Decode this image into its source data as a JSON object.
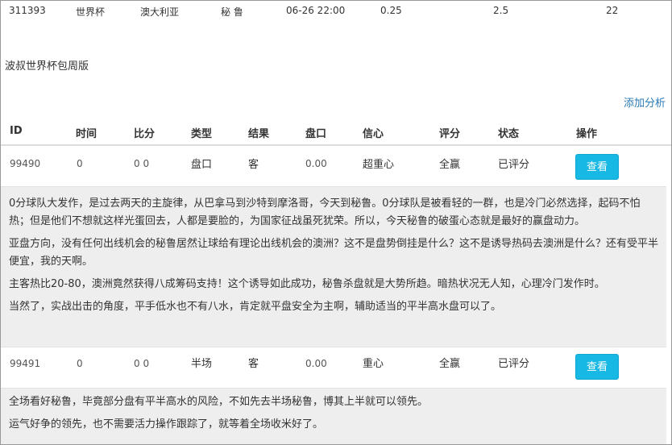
{
  "match": {
    "id": "311393",
    "league": "世界杯",
    "home": "澳大利亚",
    "away": "秘 鲁",
    "time": "06-26 22:00",
    "handicap": "0.25",
    "total": "2.5",
    "count": "22"
  },
  "package_title": "波叔世界杯包周版",
  "add_analysis_label": "添加分析",
  "table": {
    "headers": [
      "ID",
      "时间",
      "比分",
      "类型",
      "结果",
      "盘口",
      "信心",
      "评分",
      "状态",
      "操作"
    ],
    "rows": [
      {
        "id": "99490",
        "time": "0",
        "score": "0 0",
        "type": "盘口",
        "result": "客",
        "line": "0.00",
        "confidence": "超重心",
        "rating": "全赢",
        "status": "已评分",
        "action": "查看",
        "analysis": [
          "0分球队大发作，是过去两天的主旋律，从巴拿马到沙特到摩洛哥，今天到秘鲁。0分球队是被看轻的一群，也是冷门必然选择，起码不怕热；但是他们不想就这样光蛋回去，人都是要脸的，为国家征战虽死犹荣。所以，今天秘鲁的破蛋心态就是最好的赢盘动力。",
          "亚盘方向，没有任何出线机会的秘鲁居然让球给有理论出线机会的澳洲？这不是盘势倒挂是什么？这不是诱导热码去澳洲是什么？还有受平半便宜，我的天啊。",
          "主客热比20-80，澳洲竟然获得八成筹码支持！这个诱导如此成功，秘鲁杀盘就是大势所趋。暗热状况无人知，心理冷门发作时。",
          "当然了，实战出击的角度，平手低水也不有八水，肯定就平盘安全为主啊，辅助适当的平半高水盘可以了。"
        ]
      },
      {
        "id": "99491",
        "time": "0",
        "score": "0 0",
        "type": "半场",
        "result": "客",
        "line": "0.00",
        "confidence": "重心",
        "rating": "全赢",
        "status": "已评分",
        "action": "查看",
        "analysis": [
          "全场看好秘鲁，毕竟部分盘有平半高水的风险，不如先去半场秘鲁，博其上半就可以领先。",
          "运气好争的领先，也不需要活力操作跟踪了，就等着全场收米好了。"
        ]
      }
    ]
  }
}
